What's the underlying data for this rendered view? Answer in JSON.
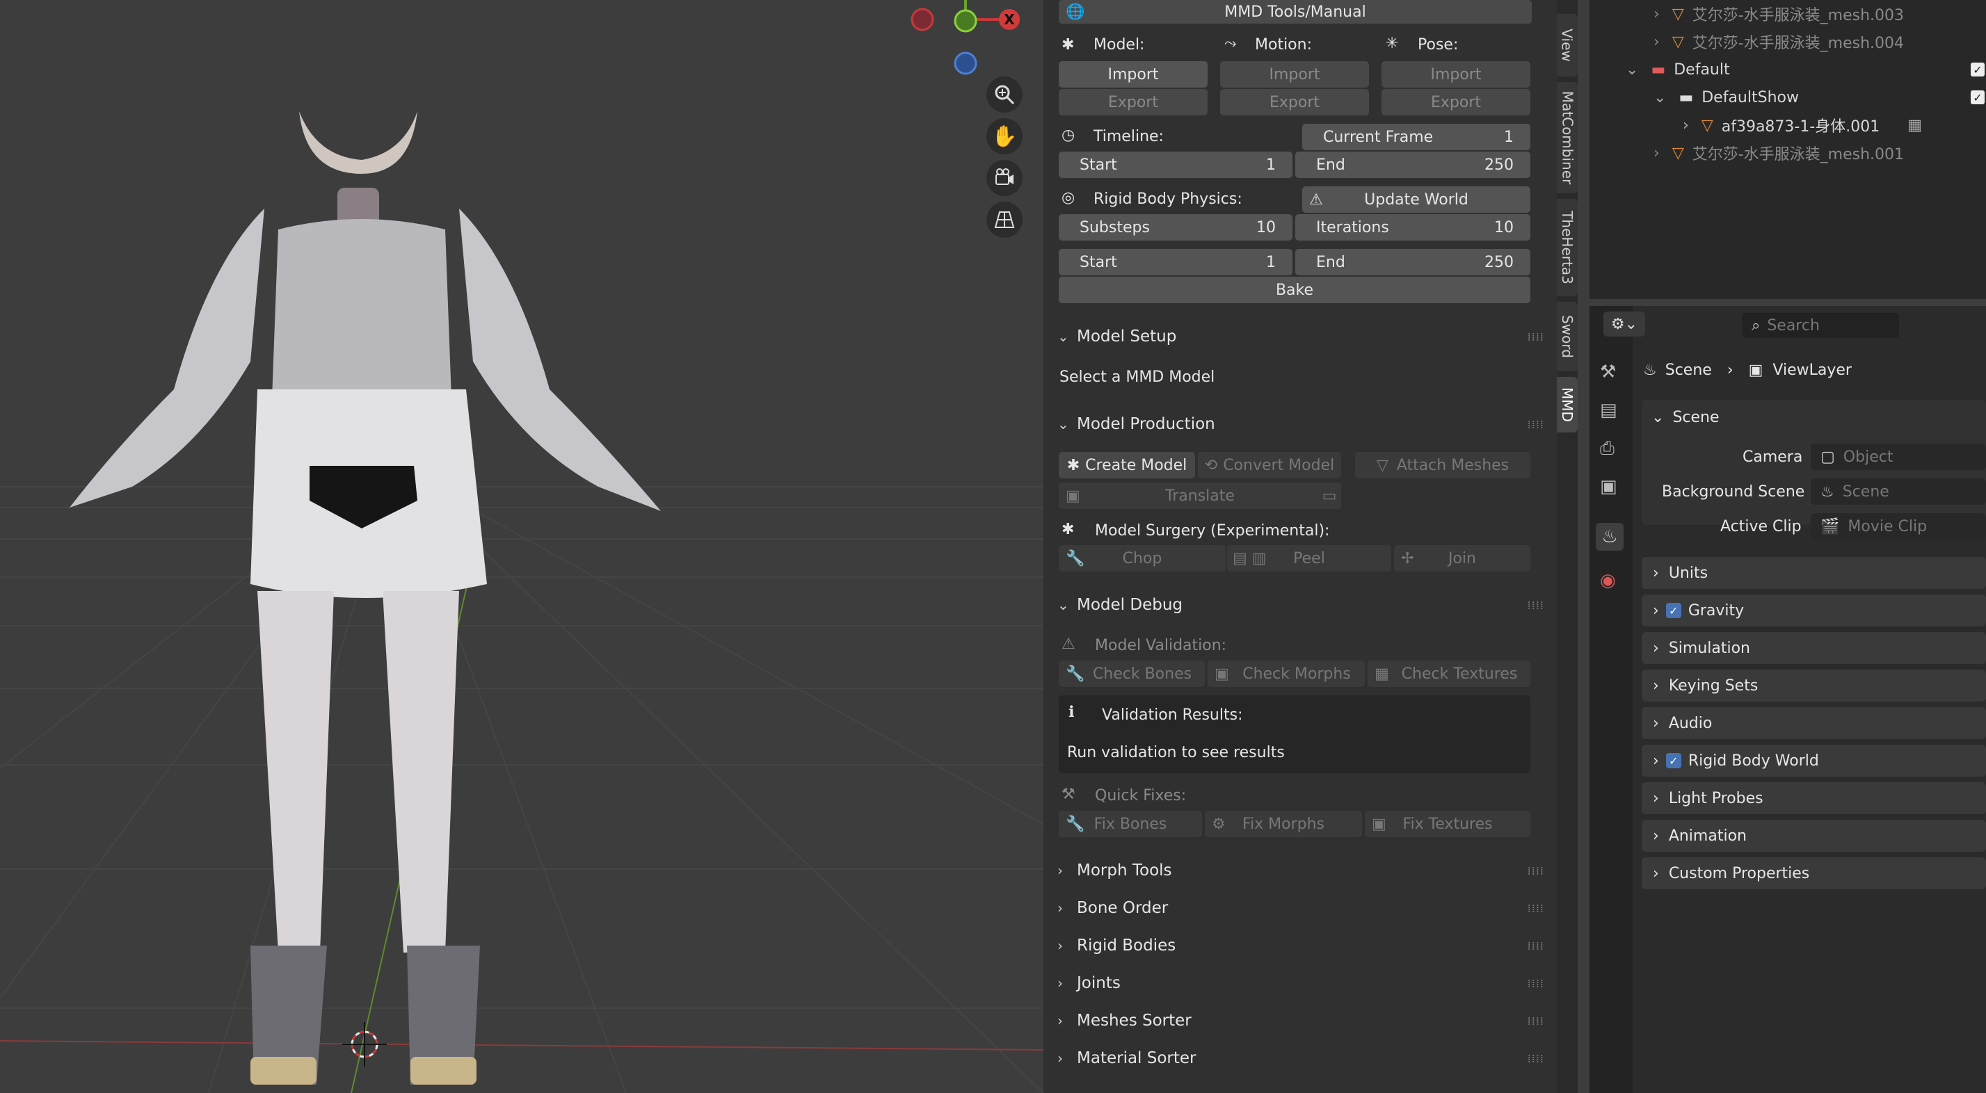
{
  "viewport": {
    "gizmo": {
      "x_label": "X"
    }
  },
  "npanel": {
    "header_title": "MMD Tools/Manual",
    "model_label": "Model:",
    "motion_label": "Motion:",
    "pose_label": "Pose:",
    "import_label": "Import",
    "export_label": "Export",
    "timeline_label": "Timeline:",
    "current_frame_label": "Current Frame",
    "current_frame_value": "1",
    "start_label": "Start",
    "start_value": "1",
    "end_label": "End",
    "end_value": "250",
    "rigid_label": "Rigid Body Physics:",
    "update_world_label": "Update World",
    "substeps_label": "Substeps",
    "substeps_value": "10",
    "iterations_label": "Iterations",
    "iterations_value": "10",
    "rb_start_label": "Start",
    "rb_start_value": "1",
    "rb_end_label": "End",
    "rb_end_value": "250",
    "bake_label": "Bake",
    "model_setup": "Model Setup",
    "select_mmd": "Select a MMD Model",
    "model_production": "Model Production",
    "create_model": "Create Model",
    "convert_model": "Convert Model",
    "attach_meshes": "Attach Meshes",
    "translate": "Translate",
    "surgery_label": "Model Surgery (Experimental):",
    "chop": "Chop",
    "peel": "Peel",
    "join": "Join",
    "model_debug": "Model Debug",
    "validation_label": "Model Validation:",
    "check_bones": "Check Bones",
    "check_morphs": "Check Morphs",
    "check_textures": "Check Textures",
    "validation_results": "Validation Results:",
    "run_validation": "Run validation to see results",
    "quick_fixes": "Quick Fixes:",
    "fix_bones": "Fix Bones",
    "fix_morphs": "Fix Morphs",
    "fix_textures": "Fix Textures",
    "collapsed_sections": [
      "Morph Tools",
      "Bone Order",
      "Rigid Bodies",
      "Joints",
      "Meshes Sorter",
      "Material Sorter"
    ]
  },
  "tabs": [
    "View",
    "MatCombiner",
    "TheHerta3",
    "Sword",
    "MMD"
  ],
  "outliner": {
    "rows": [
      {
        "label": "艾尔莎-水手服泳装_mesh.003"
      },
      {
        "label": "艾尔莎-水手服泳装_mesh.004"
      },
      {
        "label": "Default"
      },
      {
        "label": "DefaultShow"
      },
      {
        "label": "af39a873-1-身体.001"
      },
      {
        "label": "艾尔莎-水手服泳装_mesh.001"
      }
    ]
  },
  "properties": {
    "search_placeholder": "Search",
    "breadcrumb_scene": "Scene",
    "breadcrumb_viewlayer": "ViewLayer",
    "scene_section": "Scene",
    "camera_label": "Camera",
    "camera_value": "Object",
    "bg_scene_label": "Background Scene",
    "bg_scene_value": "Scene",
    "active_clip_label": "Active Clip",
    "active_clip_value": "Movie Clip",
    "sections": [
      "Units",
      "Gravity",
      "Simulation",
      "Keying Sets",
      "Audio",
      "Rigid Body World",
      "Light Probes",
      "Animation",
      "Custom Properties"
    ]
  }
}
